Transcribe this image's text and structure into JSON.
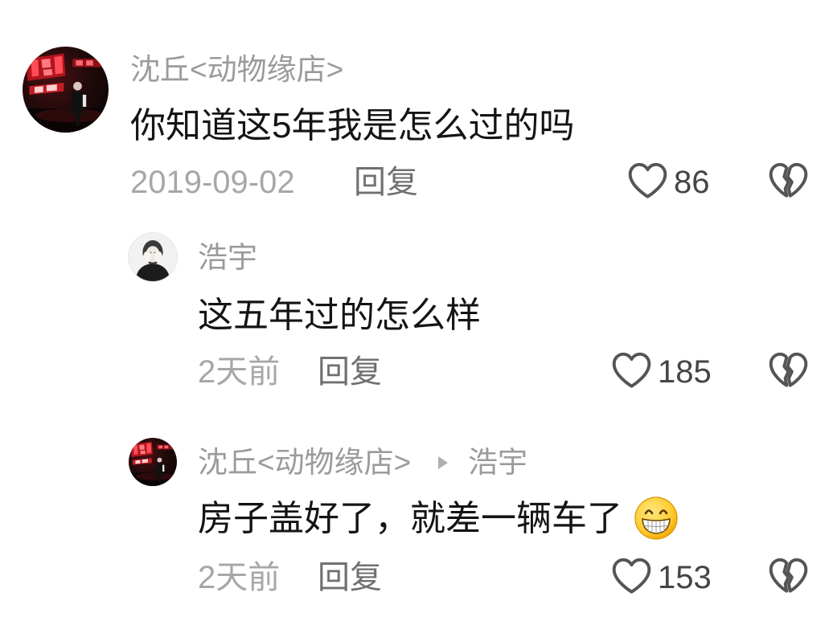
{
  "comments": [
    {
      "username": "沈丘<动物缘店>",
      "text": "你知道这5年我是怎么过的吗",
      "time": "2019-09-02",
      "reply_label": "回复",
      "likes": "86",
      "replies": [
        {
          "username": "浩宇",
          "text": "这五年过的怎么样",
          "time": "2天前",
          "reply_label": "回复",
          "likes": "185"
        },
        {
          "username": "沈丘<动物缘店>",
          "reply_to": "浩宇",
          "text": "房子盖好了，就差一辆车了",
          "emoji": "grinning-face-icon",
          "time": "2天前",
          "reply_label": "回复",
          "likes": "153"
        }
      ]
    }
  ],
  "icons": {
    "like": "heart-outline-icon",
    "dislike": "broken-heart-icon",
    "reply_to_arrow": "triangle-right-icon"
  },
  "colors": {
    "background": "#ffffff",
    "username": "#9b9b9b",
    "comment_text": "#141414",
    "timestamp": "#a7a7a7",
    "reply_link": "#707070",
    "like_count": "#454545",
    "icon_stroke": "#555555"
  }
}
